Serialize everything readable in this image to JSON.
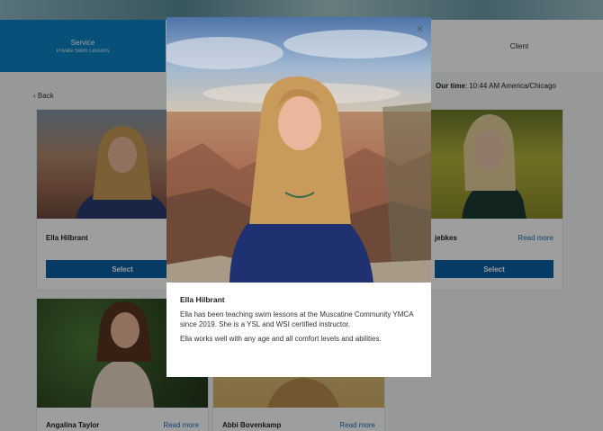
{
  "steps": {
    "service": {
      "title": "Service",
      "subtitle": "Private Swim Lessons"
    },
    "client": {
      "title": "Client"
    }
  },
  "nav": {
    "back_label": "Back"
  },
  "timezone": {
    "label": "Our time",
    "value": ": 10:44 AM America/Chicago"
  },
  "cards": [
    {
      "name": "Ella Hilbrant",
      "read_more": "Re",
      "select": "Select"
    },
    {
      "name": "jebkes",
      "read_more": "Read more",
      "select": "Select"
    },
    {
      "name": "Angalina Taylor",
      "read_more": "Read more"
    },
    {
      "name": "Abbi Bovenkamp",
      "read_more": "Read more"
    }
  ],
  "modal": {
    "close": "×",
    "name": "Ella Hilbrant",
    "bio": "Ella has been teaching swim lessons at the Muscatine Community YMCA since 2019.  She is a YSL and WSI certified instructor.",
    "bio2": "Ella works well with any age and all comfort levels and abilities."
  }
}
